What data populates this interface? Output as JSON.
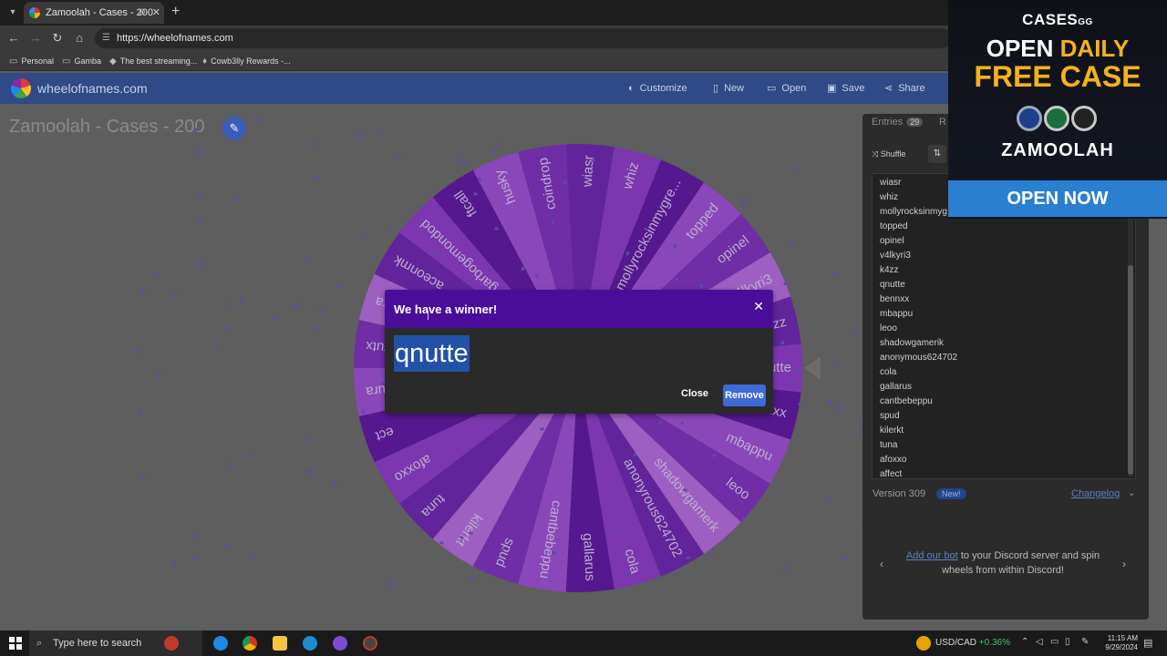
{
  "browser": {
    "tab_title": "Zamoolah - Cases - 200",
    "url": "https://wheelofnames.com",
    "bookmarks": [
      "Personal",
      "Gamba",
      "The best streaming...",
      "Cowb3lly Rewards -..."
    ]
  },
  "app": {
    "brand": "wheelofnames.com",
    "menu": [
      "Customize",
      "New",
      "Open",
      "Save",
      "Share"
    ],
    "wheel_title": "Zamoolah - Cases - 200",
    "colors": {
      "appbar": "#2f4a86",
      "modal_header": "#4a0d9a",
      "remove_button": "#3d6ad6",
      "winner_highlight": "#2451a8"
    }
  },
  "wheel": {
    "segments": [
      "wiasr",
      "whiz",
      "mollyrocksinmygre...",
      "topped",
      "opinel",
      "v4lkyri3",
      "k4zz",
      "qnutte",
      "bennxx",
      "mbappu",
      "leoo",
      "shadowgamerk",
      "anonyrous624702",
      "cola",
      "gallarus",
      "cantbebeppu",
      "spud",
      "kilerkt",
      "tuna",
      "afoxxo",
      "ect",
      "fura",
      "rutx",
      "sigmeczka",
      "aceonmk",
      "garbogemondod",
      "ftcall",
      "husky",
      "coindrop"
    ],
    "colors": [
      "#6a1fb0",
      "#8a35c8",
      "#5b10a0",
      "#9c4ad6",
      "#7a2abd",
      "#b267e0"
    ]
  },
  "sidebar": {
    "entries_label": "Entries",
    "entries_count": "29",
    "results_label": "R",
    "shuffle_label": "Shuffle",
    "entries": [
      "wiasr",
      "whiz",
      "mollyrocksinmyg",
      "topped",
      "opinel",
      "v4lkyri3",
      "k4zz",
      "qnutte",
      "bennxx",
      "mbappu",
      "leoo",
      "shadowgamerik",
      "anonymous624702",
      "cola",
      "gallarus",
      "cantbebeppu",
      "spud",
      "kilerkt",
      "tuna",
      "afoxxo",
      "affect"
    ],
    "version": "Version 309",
    "new_badge": "New!",
    "changelog": "Changelog",
    "discord_link": "Add our bot",
    "discord_text_1": "to your Discord server and spin",
    "discord_text_2": "wheels from within Discord!"
  },
  "modal": {
    "title": "We have a winner!",
    "winner": "qnutte",
    "close_label": "Close",
    "remove_label": "Remove"
  },
  "ad": {
    "brand": "CASES",
    "brand_suffix": "GG",
    "line1a": "OPEN",
    "line1b": "DAILY",
    "line2": "FREE CASE",
    "name": "ZAMOOLAH",
    "cta": "OPEN NOW"
  },
  "taskbar": {
    "search_placeholder": "Type here to search",
    "forex_label": "USD/CAD",
    "forex_change": "+0.36%",
    "time": "11:15 AM",
    "date": "9/29/2024"
  }
}
